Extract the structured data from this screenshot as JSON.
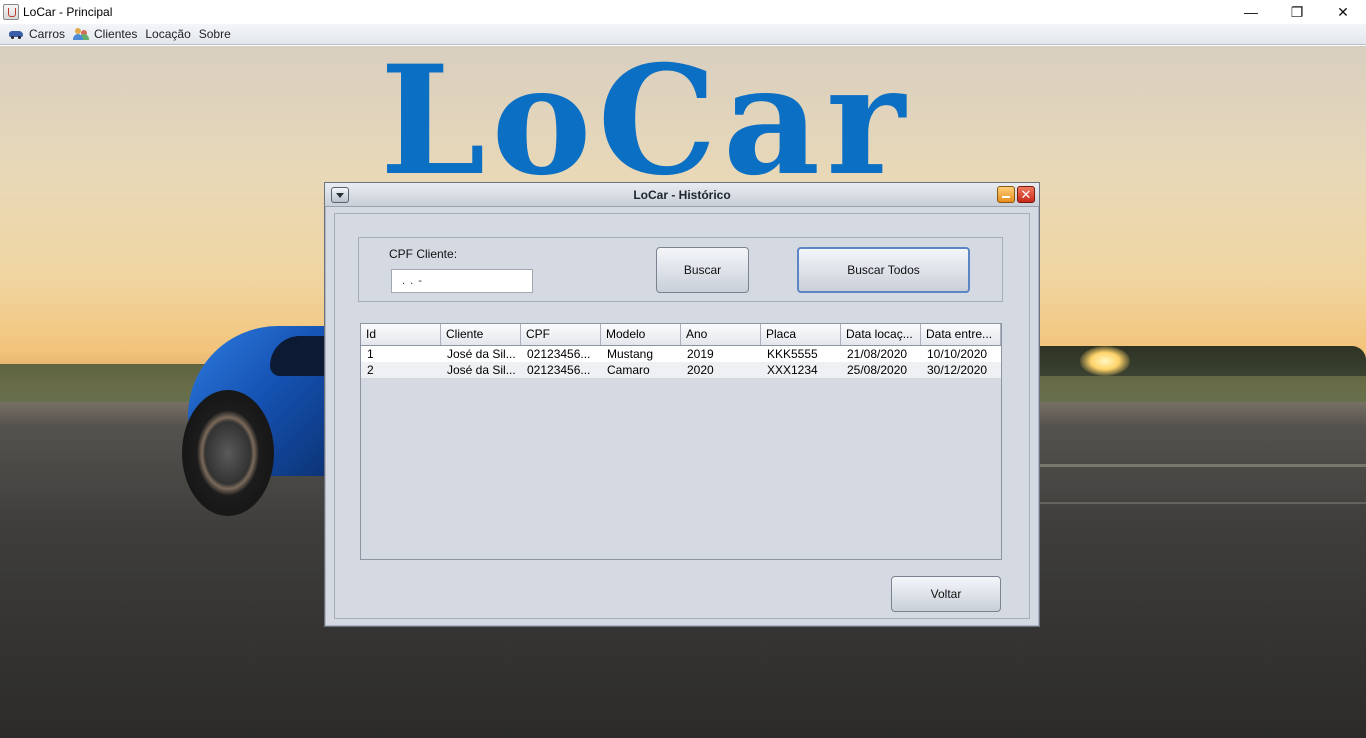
{
  "window": {
    "title": "LoCar - Principal",
    "minimize": "—",
    "maximize": "❐",
    "close": "✕"
  },
  "menu": [
    {
      "label": "Carros",
      "icon": "car-icon"
    },
    {
      "label": "Clientes",
      "icon": "users-icon"
    },
    {
      "label": "Locação",
      "icon": ""
    },
    {
      "label": "Sobre",
      "icon": ""
    }
  ],
  "logo_text": "LoCar",
  "dialog": {
    "title": "LoCar - Histórico",
    "close_glyph": "✕",
    "cpf_label": "CPF Cliente:",
    "cpf_value": ". . -",
    "buscar_label": "Buscar",
    "buscar_todos_label": "Buscar Todos",
    "voltar_label": "Voltar"
  },
  "table": {
    "columns": [
      "Id",
      "Cliente",
      "CPF",
      "Modelo",
      "Ano",
      "Placa",
      "Data locaç...",
      "Data entre..."
    ],
    "rows": [
      [
        "1",
        "José da Sil...",
        "02123456...",
        "Mustang",
        "2019",
        "KKK5555",
        "21/08/2020",
        "10/10/2020"
      ],
      [
        "2",
        "José da Sil...",
        "02123456...",
        "Camaro",
        "2020",
        "XXX1234",
        "25/08/2020",
        "30/12/2020"
      ]
    ]
  },
  "colors": {
    "accent": "#0b6fc4",
    "dialog_bg": "#d5dae2",
    "focus_border": "#5b86c5"
  }
}
